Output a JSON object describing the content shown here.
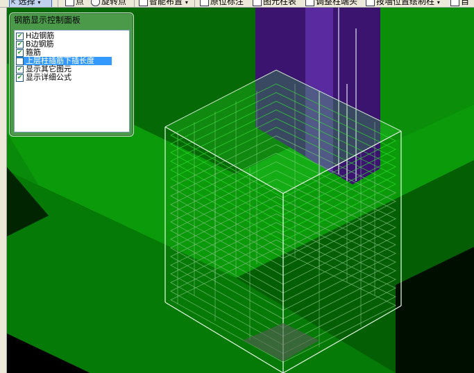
{
  "toolbar": {
    "select_label": "选择",
    "point_label": "点",
    "rotate_point_label": "旋转点",
    "smart_layout_label": "智能布置",
    "in_situ_annotation_label": "原位标注",
    "figure_table_label": "图元柱表",
    "adjust_column_end_label": "调整柱端头",
    "draw_by_wall_label": "按墙位置绘制柱",
    "truncated_label": "自"
  },
  "panel": {
    "title": "钢筋显示控制面板",
    "options": [
      {
        "label": "H边钢筋",
        "checked": true,
        "selected": false
      },
      {
        "label": "B边钢筋",
        "checked": true,
        "selected": false
      },
      {
        "label": "箍筋",
        "checked": true,
        "selected": false
      },
      {
        "label": "上层柱插筋下插长度",
        "checked": false,
        "selected": true
      },
      {
        "label": "显示其它图元",
        "checked": true,
        "selected": false
      },
      {
        "label": "显示详细公式",
        "checked": true,
        "selected": false
      }
    ]
  },
  "colors": {
    "ground_green": "#0a9a0a",
    "dark_green": "#056a05",
    "column_purple": "#4a1a8a",
    "rebar_green": "#2fe02f",
    "box_edge": "#e8ffe8"
  }
}
